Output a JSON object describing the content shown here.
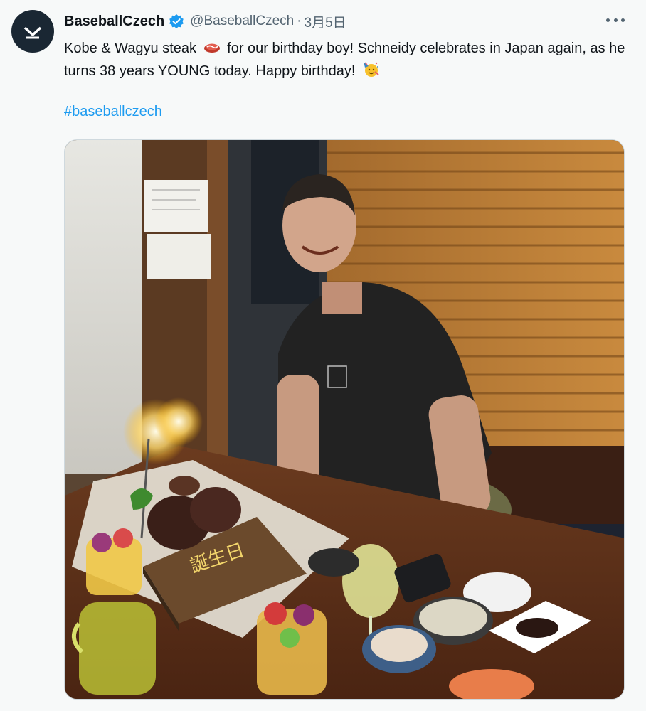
{
  "tweet": {
    "display_name": "BaseballCzech",
    "handle": "@BaseballCzech",
    "separator": "·",
    "date": "3月5日",
    "text_before_emoji1": "Kobe & Wagyu steak",
    "text_after_emoji1": "for our birthday boy! Schneidy celebrates in Japan again, as he turns 38 years YOUNG today. Happy birthday!",
    "hashtag": "#baseballczech",
    "emoji_1": "meat-emoji",
    "emoji_2": "party-face-emoji"
  },
  "photo": {
    "description_icons": [
      "sparkler",
      "steak-board",
      "fruit-cups",
      "drinks"
    ],
    "board_writing": "誕生日"
  },
  "colors": {
    "link": "#1d9bf0",
    "verified": "#1d9bf0",
    "secondary_text": "#536471",
    "avatar_bg": "#1a2733"
  }
}
